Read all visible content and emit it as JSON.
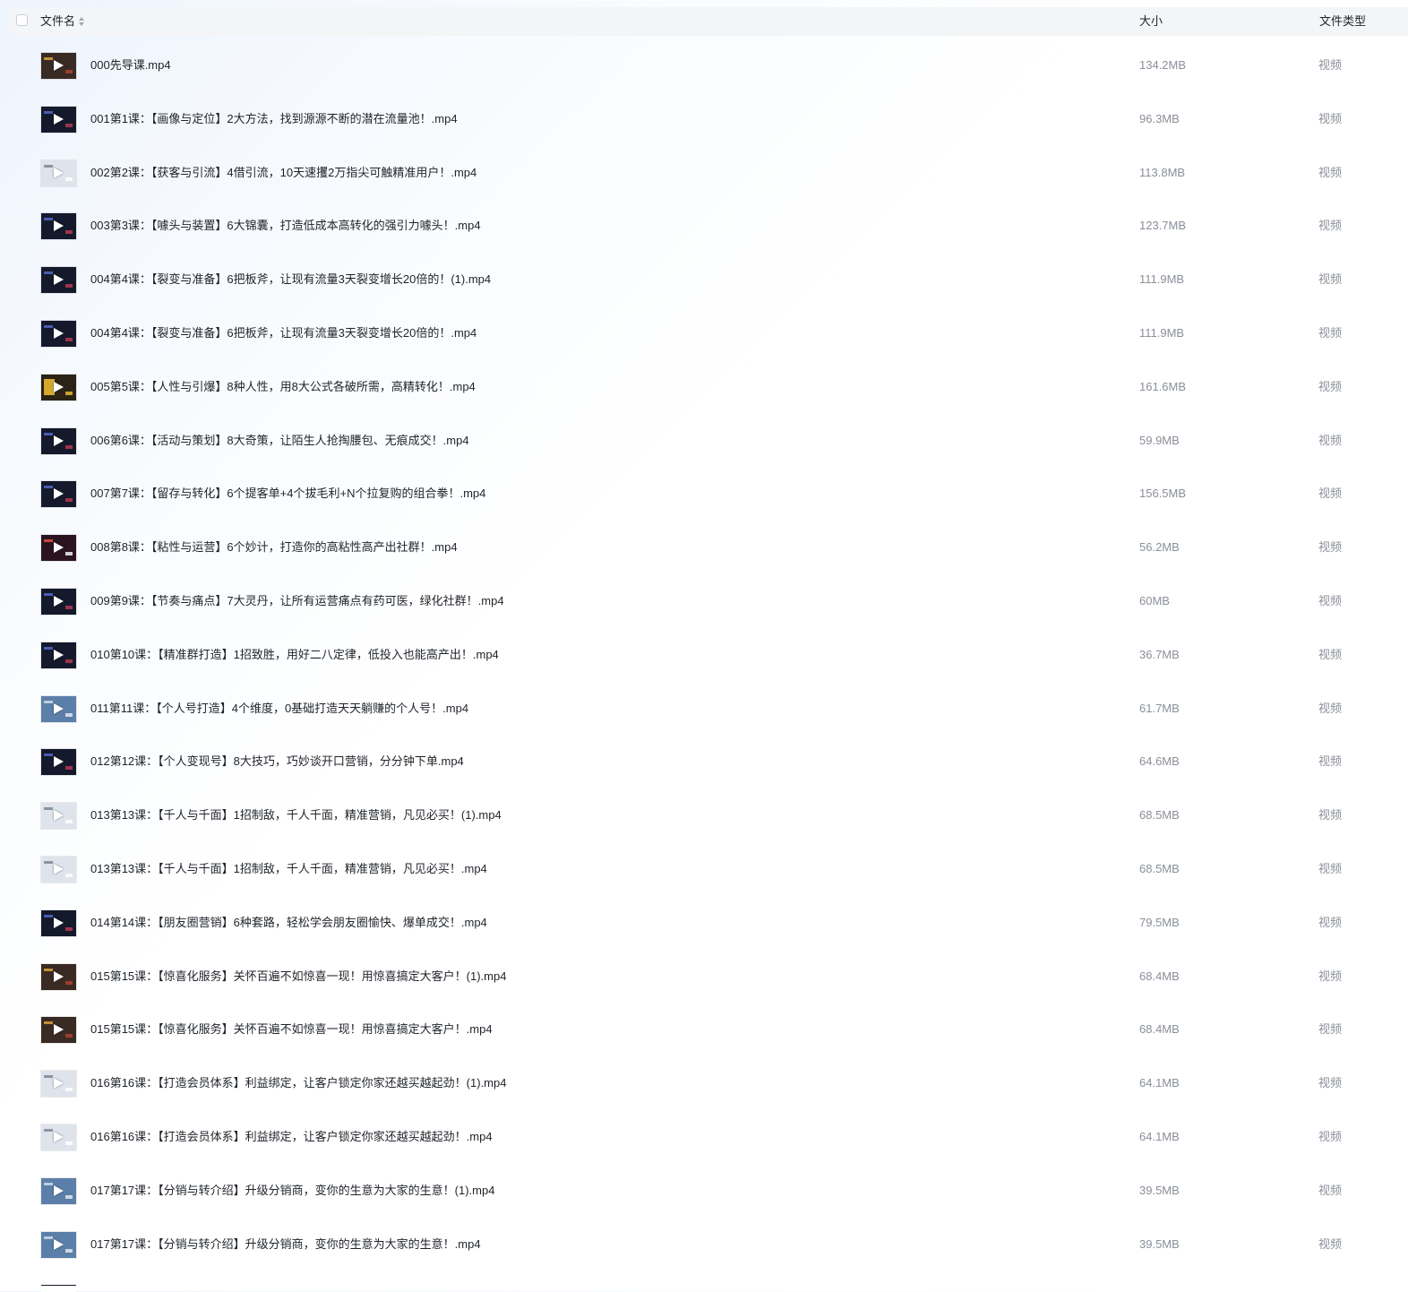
{
  "header": {
    "name_label": "文件名",
    "size_label": "大小",
    "type_label": "文件类型"
  },
  "files": [
    {
      "name": "000先导课.mp4",
      "size": "134.2MB",
      "type": "视频",
      "thumb": "warm"
    },
    {
      "name": "001第1课：【画像与定位】2大方法，找到源源不断的潜在流量池！.mp4",
      "size": "96.3MB",
      "type": "视频",
      "thumb": "dark"
    },
    {
      "name": "002第2课：【获客与引流】4借引流，10天速攫2万指尖可触精准用户！.mp4",
      "size": "113.8MB",
      "type": "视频",
      "thumb": "light"
    },
    {
      "name": "003第3课：【噱头与装置】6大锦囊，打造低成本高转化的强引力噱头！.mp4",
      "size": "123.7MB",
      "type": "视频",
      "thumb": "dark"
    },
    {
      "name": "004第4课：【裂变与准备】6把板斧，让现有流量3天裂变增长20倍的！(1).mp4",
      "size": "111.9MB",
      "type": "视频",
      "thumb": "dark"
    },
    {
      "name": "004第4课：【裂变与准备】6把板斧，让现有流量3天裂变增长20倍的！.mp4",
      "size": "111.9MB",
      "type": "视频",
      "thumb": "dark"
    },
    {
      "name": "005第5课：【人性与引爆】8种人性，用8大公式各破所需，高精转化！.mp4",
      "size": "161.6MB",
      "type": "视频",
      "thumb": "yellow"
    },
    {
      "name": "006第6课：【活动与策划】8大奇策，让陌生人抢掏腰包、无痕成交！.mp4",
      "size": "59.9MB",
      "type": "视频",
      "thumb": "dark"
    },
    {
      "name": "007第7课：【留存与转化】6个提客单+4个拔毛利+N个拉复购的组合拳！.mp4",
      "size": "156.5MB",
      "type": "视频",
      "thumb": "dark"
    },
    {
      "name": "008第8课：【粘性与运营】6个妙计，打造你的高粘性高产出社群！.mp4",
      "size": "56.2MB",
      "type": "视频",
      "thumb": "red"
    },
    {
      "name": "009第9课：【节奏与痛点】7大灵丹，让所有运营痛点有药可医，绿化社群！.mp4",
      "size": "60MB",
      "type": "视频",
      "thumb": "dark"
    },
    {
      "name": "010第10课：【精准群打造】1招致胜，用好二八定律，低投入也能高产出！.mp4",
      "size": "36.7MB",
      "type": "视频",
      "thumb": "dark"
    },
    {
      "name": "011第11课：【个人号打造】4个维度，0基础打造天天躺赚的个人号！.mp4",
      "size": "61.7MB",
      "type": "视频",
      "thumb": "blue"
    },
    {
      "name": "012第12课：【个人变现号】8大技巧，巧妙谈开口营销，分分钟下单.mp4",
      "size": "64.6MB",
      "type": "视频",
      "thumb": "dark"
    },
    {
      "name": "013第13课：【千人与千面】1招制敌，千人千面，精准营销，凡见必买！(1).mp4",
      "size": "68.5MB",
      "type": "视频",
      "thumb": "light"
    },
    {
      "name": "013第13课：【千人与千面】1招制敌，千人千面，精准营销，凡见必买！.mp4",
      "size": "68.5MB",
      "type": "视频",
      "thumb": "light"
    },
    {
      "name": "014第14课：【朋友圈营销】6种套路，轻松学会朋友圈愉快、爆单成交！.mp4",
      "size": "79.5MB",
      "type": "视频",
      "thumb": "dark"
    },
    {
      "name": "015第15课：【惊喜化服务】关怀百遍不如惊喜一现！用惊喜搞定大客户！(1).mp4",
      "size": "68.4MB",
      "type": "视频",
      "thumb": "warm"
    },
    {
      "name": "015第15课：【惊喜化服务】关怀百遍不如惊喜一现！用惊喜搞定大客户！.mp4",
      "size": "68.4MB",
      "type": "视频",
      "thumb": "warm"
    },
    {
      "name": "016第16课：【打造会员体系】利益绑定，让客户锁定你家还越买越起劲！(1).mp4",
      "size": "64.1MB",
      "type": "视频",
      "thumb": "light"
    },
    {
      "name": "016第16课：【打造会员体系】利益绑定，让客户锁定你家还越买越起劲！.mp4",
      "size": "64.1MB",
      "type": "视频",
      "thumb": "light"
    },
    {
      "name": "017第17课：【分销与转介绍】升级分销商，变你的生意为大家的生意！(1).mp4",
      "size": "39.5MB",
      "type": "视频",
      "thumb": "blue"
    },
    {
      "name": "017第17课：【分销与转介绍】升级分销商，变你的生意为大家的生意！.mp4",
      "size": "39.5MB",
      "type": "视频",
      "thumb": "blue"
    }
  ]
}
